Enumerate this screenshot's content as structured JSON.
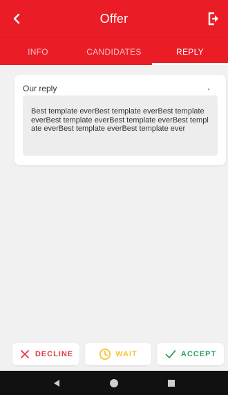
{
  "header": {
    "title": "Offer",
    "back_icon": "chevron-left-icon",
    "logout_icon": "logout-icon"
  },
  "tabs": [
    {
      "label": "INFO",
      "active": false
    },
    {
      "label": "CANDIDATES",
      "active": false
    },
    {
      "label": "REPLY",
      "active": true
    }
  ],
  "reply_card": {
    "label": "Our reply",
    "text": "Best template everBest template everBest template everBest template everBest template everBest template everBest template everBest template ever"
  },
  "actions": {
    "decline_label": "DECLINE",
    "wait_label": "WAIT",
    "accept_label": "ACCEPT"
  },
  "colors": {
    "brand": "#ea1d26",
    "decline": "#e23b44",
    "wait": "#f6c533",
    "accept": "#2da25a"
  }
}
